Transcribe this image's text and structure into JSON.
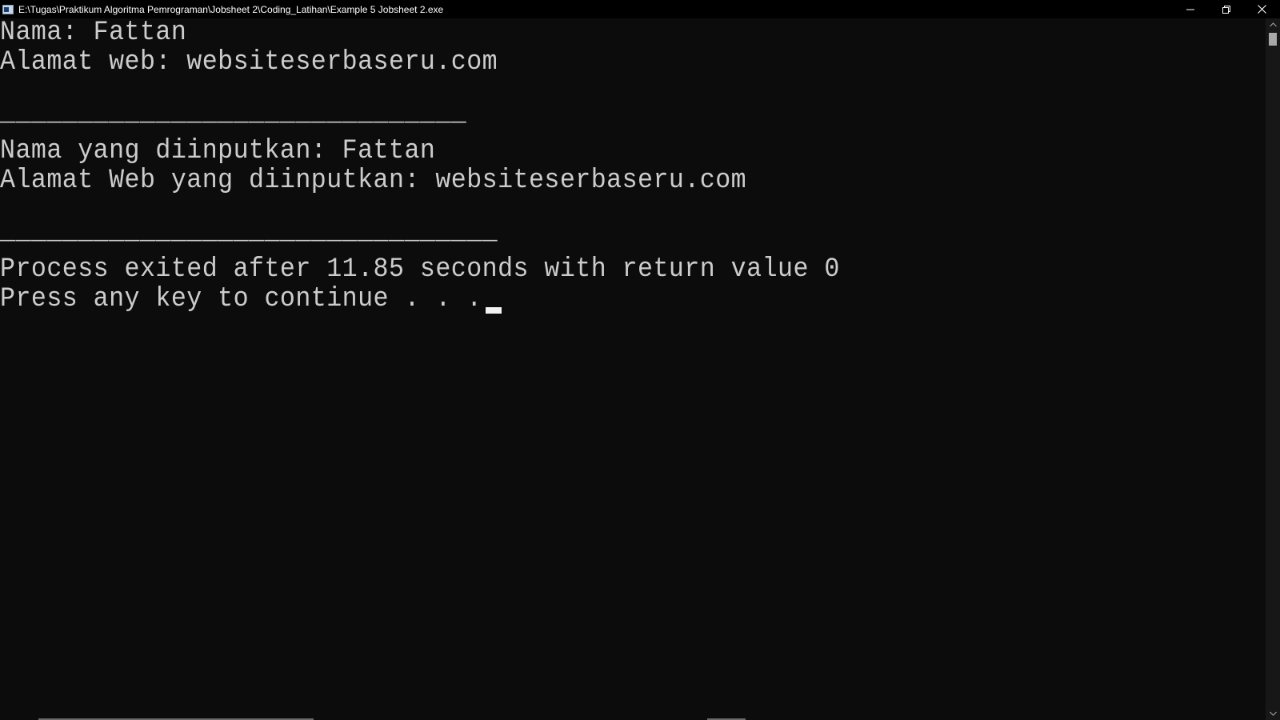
{
  "window": {
    "title": "E:\\Tugas\\Praktikum Algoritma Pemrograman\\Jobsheet 2\\Coding_Latihan\\Example 5 Jobsheet 2.exe"
  },
  "console": {
    "lines": [
      "Nama: Fattan",
      "Alamat web: websiteserbaseru.com",
      "",
      "______________________________",
      "Nama yang diinputkan: Fattan",
      "Alamat Web yang diinputkan: websiteserbaseru.com",
      "",
      "________________________________",
      "Process exited after 11.85 seconds with return value 0",
      "Press any key to continue . . ."
    ]
  },
  "icons": {
    "app": "console-app-icon",
    "minimize": "minimize-icon",
    "restore": "restore-icon",
    "close": "close-icon",
    "scroll_up": "chevron-up-icon",
    "scroll_down": "chevron-down-icon"
  },
  "colors": {
    "console_bg": "#0c0c0c",
    "console_text": "#cccccc",
    "titlebar_bg": "#000000"
  }
}
